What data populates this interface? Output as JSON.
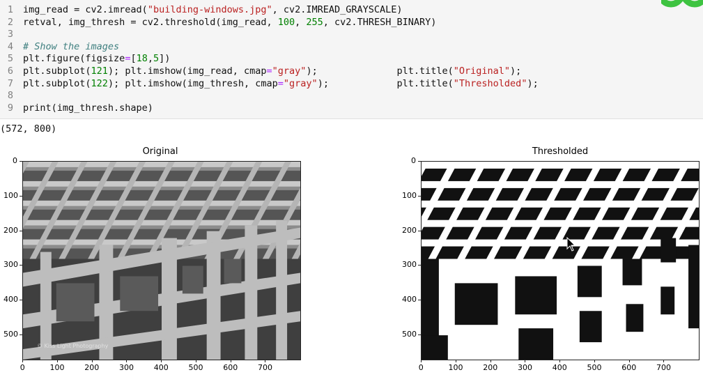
{
  "code": {
    "lines": [
      {
        "num": "1",
        "parts": [
          [
            "",
            "img_read = cv2.imread("
          ],
          [
            "str",
            "\"building-windows.jpg\""
          ],
          [
            "",
            ", cv2.IMREAD_GRAYSCALE)"
          ]
        ]
      },
      {
        "num": "2",
        "parts": [
          [
            "",
            "retval, img_thresh = cv2.threshold(img_read, "
          ],
          [
            "num",
            "100"
          ],
          [
            "",
            ", "
          ],
          [
            "num",
            "255"
          ],
          [
            "",
            ", cv2.THRESH_BINARY)"
          ]
        ]
      },
      {
        "num": "3",
        "parts": []
      },
      {
        "num": "4",
        "parts": [
          [
            "cmt",
            "# Show the images"
          ]
        ]
      },
      {
        "num": "5",
        "parts": [
          [
            "",
            "plt.figure(figsize"
          ],
          [
            "op",
            "="
          ],
          [
            "",
            "["
          ],
          [
            "num",
            "18"
          ],
          [
            "",
            ","
          ],
          [
            "num",
            "5"
          ],
          [
            "",
            "])"
          ]
        ]
      },
      {
        "num": "6",
        "parts": [
          [
            "",
            "plt.subplot("
          ],
          [
            "num",
            "121"
          ],
          [
            "",
            "); plt.imshow(img_read, cmap"
          ],
          [
            "op",
            "="
          ],
          [
            "str",
            "\"gray\""
          ],
          [
            "",
            ");              plt.title("
          ],
          [
            "str",
            "\"Original\""
          ],
          [
            "",
            ");"
          ]
        ]
      },
      {
        "num": "7",
        "parts": [
          [
            "",
            "plt.subplot("
          ],
          [
            "num",
            "122"
          ],
          [
            "",
            "); plt.imshow(img_thresh, cmap"
          ],
          [
            "op",
            "="
          ],
          [
            "str",
            "\"gray\""
          ],
          [
            "",
            ");            plt.title("
          ],
          [
            "str",
            "\"Thresholded\""
          ],
          [
            "",
            ");"
          ]
        ]
      },
      {
        "num": "8",
        "parts": []
      },
      {
        "num": "9",
        "parts": [
          [
            "",
            "print(img_thresh.shape)"
          ]
        ]
      }
    ]
  },
  "output": {
    "shape_text": "(572, 800)"
  },
  "plots": [
    {
      "title": "Original",
      "y_ticks": [
        "0",
        "100",
        "200",
        "300",
        "400",
        "500"
      ],
      "x_ticks": [
        "0",
        "100",
        "200",
        "300",
        "400",
        "500",
        "600",
        "700"
      ],
      "watermark": "© Kiss Light Photography"
    },
    {
      "title": "Thresholded",
      "y_ticks": [
        "0",
        "100",
        "200",
        "300",
        "400",
        "500"
      ],
      "x_ticks": [
        "0",
        "100",
        "200",
        "300",
        "400",
        "500",
        "600",
        "700"
      ]
    }
  ],
  "colors": {
    "string": "#ba2121",
    "number": "#008000",
    "comment": "#408080",
    "operator": "#aa22ff",
    "logo_green": "#3ec341"
  }
}
